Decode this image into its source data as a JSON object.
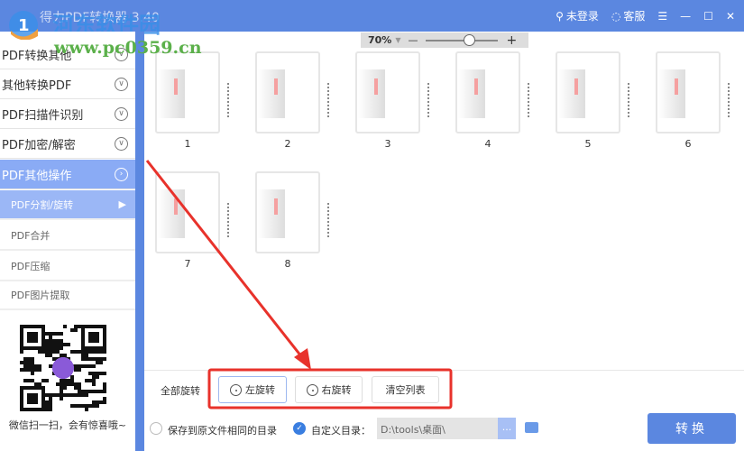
{
  "title": "得力PDF转换器 3.40",
  "watermark": {
    "name": "河东软件园",
    "url": "www.pc0359.cn"
  },
  "titlebar": {
    "login": "未登录",
    "service": "客服"
  },
  "sidebar": {
    "menus": [
      "PDF转换其他",
      "其他转换PDF",
      "PDF扫描件识别",
      "PDF加密/解密",
      "PDF其他操作"
    ],
    "subs": [
      "PDF分割/旋转",
      "PDF合并",
      "PDF压缩",
      "PDF图片提取"
    ],
    "qr_text": "微信扫一扫，会有惊喜哦~"
  },
  "zoom": {
    "level": "70%",
    "slider_fraction": 0.6
  },
  "pages": [
    "1",
    "2",
    "3",
    "4",
    "5",
    "6",
    "7",
    "8"
  ],
  "actions": {
    "label": "全部旋转",
    "rotate_left": "左旋转",
    "rotate_right": "右旋转",
    "clear": "清空列表"
  },
  "output": {
    "same_dir": "保存到原文件相同的目录",
    "custom_dir": "自定义目录：",
    "path": "D:\\tools\\桌面\\",
    "browse": "...",
    "convert": "转换"
  },
  "colors": {
    "accent": "#5b87e0",
    "highlight": "#8aabf5",
    "annotation": "#e8322b"
  }
}
